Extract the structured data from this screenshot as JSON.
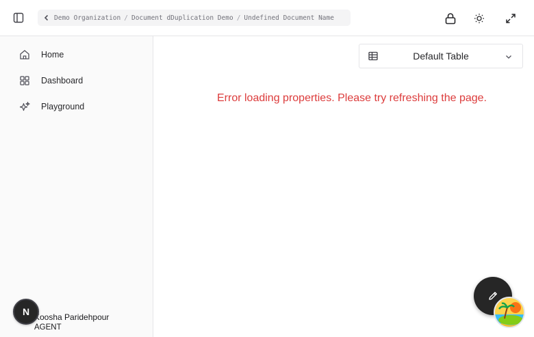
{
  "header": {
    "breadcrumb": {
      "back_icon": "chevron-left-icon",
      "items": [
        "Demo Organization",
        "Document dDuplication Demo",
        "Undefined Document Name"
      ],
      "separator": "/"
    },
    "icons": {
      "sidebar_toggle": "panel-left-icon",
      "lock": "lock-icon",
      "theme": "sun-icon",
      "fullscreen": "expand-icon"
    }
  },
  "sidebar": {
    "items": [
      {
        "label": "Home",
        "icon": "home-icon"
      },
      {
        "label": "Dashboard",
        "icon": "dashboard-icon"
      },
      {
        "label": "Playground",
        "icon": "sparkles-icon"
      }
    ],
    "user": {
      "avatar_letter": "N",
      "name": "Koosha Paridehpour",
      "role": "AGENT"
    }
  },
  "main": {
    "table_select": {
      "icon": "table-icon",
      "value": "Default Table"
    },
    "error": "Error loading properties. Please try refreshing the page.",
    "fab_icon": "pencil-icon"
  },
  "colors": {
    "error": "#dc3b3b",
    "sidebar_bg": "#fafafa",
    "fab_bg": "#262626",
    "border": "#e4e4e7"
  }
}
